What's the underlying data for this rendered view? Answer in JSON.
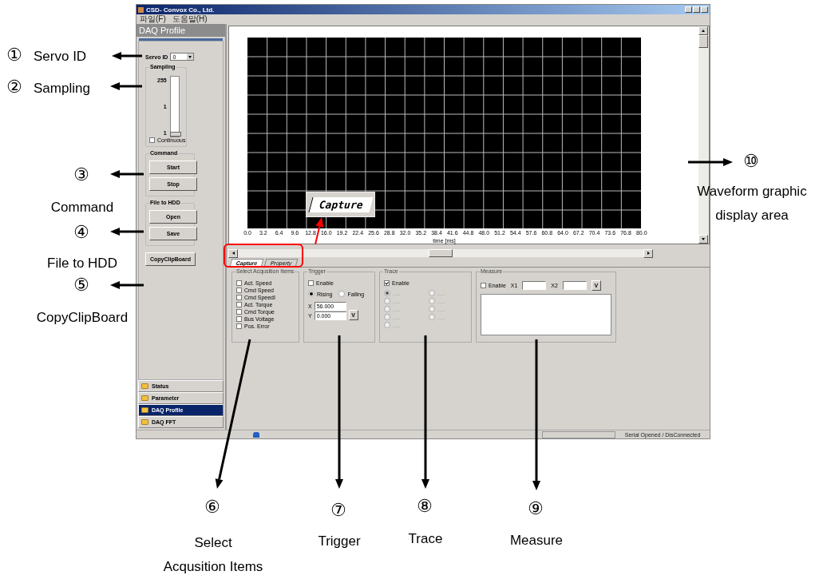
{
  "window": {
    "title": "CSD- Convox Co., Ltd.",
    "menu": [
      "파일(F)",
      "도움말(H)"
    ]
  },
  "side_panel": {
    "header": "DAQ Profile",
    "servo_id": {
      "label": "Servo ID",
      "value": "0"
    },
    "sampling": {
      "title": "Sampling",
      "scale": [
        "255",
        "1",
        "1"
      ],
      "level": 0,
      "continuous": {
        "label": "Continuous",
        "checked": false
      }
    },
    "command": {
      "title": "Command",
      "buttons": [
        "Start",
        "Stop"
      ]
    },
    "file_to_hdd": {
      "title": "File to HDD",
      "buttons": [
        "Open",
        "Save"
      ]
    },
    "copy_button": "CopyClipBoard",
    "nav": [
      {
        "label": "Status",
        "selected": false
      },
      {
        "label": "Parameter",
        "selected": false
      },
      {
        "label": "DAQ Profile",
        "selected": true
      },
      {
        "label": "DAQ FFT",
        "selected": false
      }
    ]
  },
  "plot": {
    "x_ticks": [
      "0.0",
      "3.2",
      "6.4",
      "9.6",
      "12.8",
      "16.0",
      "19.2",
      "22.4",
      "25.6",
      "28.8",
      "32.0",
      "35.2",
      "38.4",
      "41.6",
      "44.8",
      "48.0",
      "51.2",
      "54.4",
      "57.6",
      "60.8",
      "64.0",
      "67.2",
      "70.4",
      "73.6",
      "76.8",
      "80.0"
    ],
    "xlabel": "time [ms]"
  },
  "tabs": [
    {
      "label": "Capture",
      "selected": true
    },
    {
      "label": "Property",
      "selected": false
    }
  ],
  "acquisition": {
    "title": "Select Acqusition Items",
    "items": [
      {
        "label": "Act. Speed",
        "checked": false
      },
      {
        "label": "Cmd Speed",
        "checked": false
      },
      {
        "label": "Cmd SpeedI",
        "checked": false
      },
      {
        "label": "Act. Torque",
        "checked": false
      },
      {
        "label": "Cmd Torque",
        "checked": false
      },
      {
        "label": "Bus Voltage",
        "checked": false
      },
      {
        "label": "Pos. Error",
        "checked": false
      }
    ]
  },
  "trigger": {
    "title": "Trigger",
    "enable": {
      "label": "Enable",
      "checked": false
    },
    "edges": [
      {
        "label": "Rising",
        "selected": true
      },
      {
        "label": "Falling",
        "selected": false
      }
    ],
    "x": {
      "label": "X",
      "value": "56.000"
    },
    "y": {
      "label": "Y",
      "value": "0.000"
    },
    "button": "V"
  },
  "trace": {
    "title": "Trace",
    "enable": {
      "label": "Enable",
      "checked": true
    },
    "channels": [
      {
        "label": ".....",
        "selected": true,
        "disabled": true
      },
      {
        "label": ".....",
        "selected": false,
        "disabled": true
      },
      {
        "label": ".....",
        "selected": false,
        "disabled": true
      },
      {
        "label": ".....",
        "selected": false,
        "disabled": true
      },
      {
        "label": ".....",
        "selected": false,
        "disabled": true
      },
      {
        "label": ".....",
        "selected": false,
        "disabled": true
      },
      {
        "label": ".....",
        "selected": false,
        "disabled": true
      },
      {
        "label": ".....",
        "selected": false,
        "disabled": true
      },
      {
        "label": ".....",
        "selected": false,
        "disabled": true
      }
    ]
  },
  "measure": {
    "title": "Measure",
    "enable": {
      "label": "Enable",
      "checked": false
    },
    "x1_label": "X1",
    "x2_label": "X2",
    "button": "V"
  },
  "status_bar": {
    "text": "Serial Opened / DisConnected"
  },
  "callout": {
    "label": "Capture"
  },
  "annotations": [
    {
      "number": "①",
      "text": "Servo ID"
    },
    {
      "number": "②",
      "text": "Sampling"
    },
    {
      "number": "③",
      "text": "Command"
    },
    {
      "number": "④",
      "text": "File to HDD"
    },
    {
      "number": "⑤",
      "text": "CopyClipBoard"
    },
    {
      "number": "⑥",
      "text": "Select\nAcqusition Items"
    },
    {
      "number": "⑦",
      "text": "Trigger"
    },
    {
      "number": "⑧",
      "text": "Trace"
    },
    {
      "number": "⑨",
      "text": "Measure"
    },
    {
      "number": "⑩",
      "text": "Waveform graphic\ndisplay area"
    }
  ]
}
